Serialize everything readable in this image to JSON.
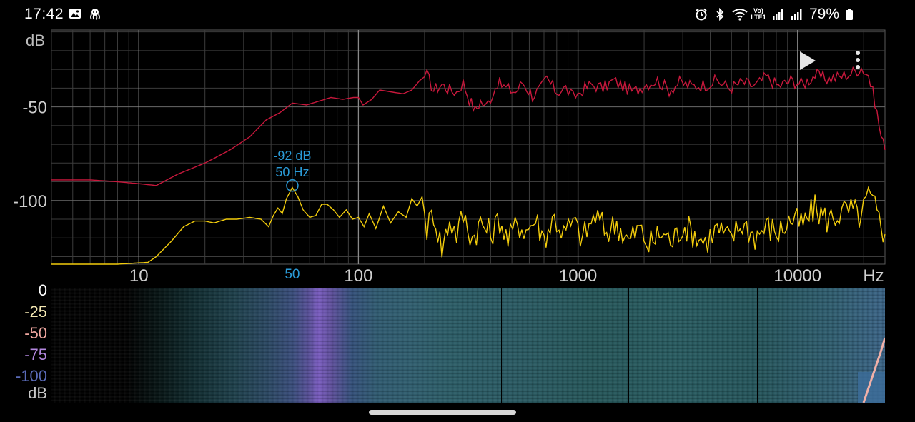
{
  "status_bar": {
    "time": "17:42",
    "battery": "79%",
    "left_icons": [
      "image-icon",
      "octopus-icon"
    ],
    "right_icons": [
      "alarm-icon",
      "bluetooth-icon",
      "wifi-icon",
      "volte-icon",
      "signal-icon",
      "signal-icon-2",
      "battery-icon"
    ],
    "volte_label": "Vo)\nLTE1"
  },
  "spectrum": {
    "db_unit": "dB",
    "hz_unit": "Hz",
    "peak_marker": {
      "db_text": "-92 dB",
      "hz_text": "50 Hz",
      "freq": 50,
      "db": -92
    },
    "marker_tick_label": "50",
    "colors": {
      "red": "#c8183c",
      "yellow": "#f2cc0c",
      "marker": "#2a9ad6",
      "grid": "#3c3c3c",
      "major_grid": "#8a8a8a"
    }
  },
  "chart_data": {
    "type": "line",
    "title": "",
    "xlabel": "Hz",
    "ylabel": "dB",
    "x_scale": "log",
    "xlim": [
      4,
      25000
    ],
    "ylim": [
      -134,
      -9
    ],
    "x_ticks": [
      {
        "value": 10,
        "label": "10"
      },
      {
        "value": 100,
        "label": "100"
      },
      {
        "value": 1000,
        "label": "1000"
      },
      {
        "value": 10000,
        "label": "10000"
      }
    ],
    "y_ticks": [
      {
        "value": -50,
        "label": "-50"
      },
      {
        "value": -100,
        "label": "-100"
      }
    ],
    "grid": true,
    "series": [
      {
        "color": "#c8183c",
        "points": [
          [
            4,
            -89
          ],
          [
            6,
            -89
          ],
          [
            8,
            -90
          ],
          [
            10,
            -91
          ],
          [
            12,
            -92
          ],
          [
            15,
            -86
          ],
          [
            20,
            -80
          ],
          [
            26,
            -73
          ],
          [
            32,
            -66
          ],
          [
            38,
            -57
          ],
          [
            44,
            -53
          ],
          [
            50,
            -48
          ],
          [
            58,
            -49
          ],
          [
            66,
            -47
          ],
          [
            75,
            -45
          ],
          [
            85,
            -46
          ],
          [
            95,
            -45
          ],
          [
            100,
            -45
          ],
          [
            105,
            -49
          ],
          [
            115,
            -46
          ],
          [
            125,
            -41
          ],
          [
            140,
            -42
          ],
          [
            160,
            -43
          ],
          [
            175,
            -41
          ],
          [
            190,
            -36
          ],
          [
            205,
            -33
          ],
          [
            220,
            -41
          ],
          [
            240,
            -38
          ],
          [
            260,
            -41
          ],
          [
            280,
            -42
          ],
          [
            300,
            -37
          ],
          [
            320,
            -46
          ],
          [
            340,
            -52
          ],
          [
            360,
            -47
          ],
          [
            380,
            -50
          ],
          [
            400,
            -45
          ],
          [
            430,
            -37
          ],
          [
            470,
            -40
          ],
          [
            520,
            -42
          ],
          [
            560,
            -37
          ],
          [
            620,
            -44
          ],
          [
            680,
            -40
          ],
          [
            720,
            -35
          ],
          [
            800,
            -42
          ],
          [
            880,
            -40
          ],
          [
            950,
            -45
          ],
          [
            1050,
            -41
          ],
          [
            1150,
            -38
          ],
          [
            1300,
            -40
          ],
          [
            1450,
            -36
          ],
          [
            1600,
            -39
          ],
          [
            1800,
            -42
          ],
          [
            2000,
            -38
          ],
          [
            2300,
            -36
          ],
          [
            2600,
            -41
          ],
          [
            2900,
            -37
          ],
          [
            3300,
            -39
          ],
          [
            3800,
            -38
          ],
          [
            4300,
            -36
          ],
          [
            4900,
            -40
          ],
          [
            5600,
            -37
          ],
          [
            6400,
            -39
          ],
          [
            7200,
            -34
          ],
          [
            8200,
            -39
          ],
          [
            9300,
            -36
          ],
          [
            10600,
            -38
          ],
          [
            12000,
            -33
          ],
          [
            13600,
            -35
          ],
          [
            15500,
            -34
          ],
          [
            17500,
            -32
          ],
          [
            19500,
            -29
          ],
          [
            21000,
            -33
          ],
          [
            22500,
            -47
          ],
          [
            24000,
            -66
          ],
          [
            25000,
            -73
          ]
        ]
      },
      {
        "color": "#f2cc0c",
        "points": [
          [
            4,
            -134
          ],
          [
            8,
            -134
          ],
          [
            11,
            -133
          ],
          [
            12,
            -130
          ],
          [
            14,
            -122
          ],
          [
            16,
            -114
          ],
          [
            18,
            -111
          ],
          [
            20,
            -111
          ],
          [
            22,
            -112
          ],
          [
            25,
            -110
          ],
          [
            28,
            -110
          ],
          [
            32,
            -109
          ],
          [
            36,
            -110
          ],
          [
            39,
            -114
          ],
          [
            41,
            -108
          ],
          [
            43,
            -104
          ],
          [
            45,
            -107
          ],
          [
            47,
            -99
          ],
          [
            50,
            -93
          ],
          [
            53,
            -98
          ],
          [
            56,
            -105
          ],
          [
            60,
            -109
          ],
          [
            64,
            -108
          ],
          [
            68,
            -102
          ],
          [
            72,
            -102
          ],
          [
            77,
            -105
          ],
          [
            82,
            -109
          ],
          [
            88,
            -105
          ],
          [
            94,
            -110
          ],
          [
            100,
            -109
          ],
          [
            106,
            -114
          ],
          [
            112,
            -107
          ],
          [
            120,
            -115
          ],
          [
            130,
            -103
          ],
          [
            140,
            -112
          ],
          [
            152,
            -106
          ],
          [
            165,
            -109
          ],
          [
            175,
            -99
          ],
          [
            185,
            -103
          ],
          [
            195,
            -98
          ],
          [
            205,
            -115
          ],
          [
            220,
            -106
          ],
          [
            240,
            -126
          ],
          [
            260,
            -110
          ],
          [
            280,
            -118
          ],
          [
            300,
            -108
          ],
          [
            330,
            -120
          ],
          [
            360,
            -112
          ],
          [
            400,
            -118
          ],
          [
            440,
            -110
          ],
          [
            480,
            -122
          ],
          [
            530,
            -112
          ],
          [
            580,
            -116
          ],
          [
            640,
            -110
          ],
          [
            700,
            -120
          ],
          [
            780,
            -109
          ],
          [
            860,
            -118
          ],
          [
            950,
            -112
          ],
          [
            1050,
            -120
          ],
          [
            1200,
            -108
          ],
          [
            1350,
            -117
          ],
          [
            1500,
            -112
          ],
          [
            1700,
            -122
          ],
          [
            1900,
            -115
          ],
          [
            2100,
            -124
          ],
          [
            2400,
            -117
          ],
          [
            2700,
            -122
          ],
          [
            3000,
            -113
          ],
          [
            3400,
            -118
          ],
          [
            3800,
            -122
          ],
          [
            4300,
            -115
          ],
          [
            4900,
            -121
          ],
          [
            5600,
            -112
          ],
          [
            6400,
            -119
          ],
          [
            7200,
            -114
          ],
          [
            8200,
            -117
          ],
          [
            9300,
            -110
          ],
          [
            10600,
            -113
          ],
          [
            12000,
            -104
          ],
          [
            13600,
            -110
          ],
          [
            15500,
            -107
          ],
          [
            17500,
            -105
          ],
          [
            19500,
            -109
          ],
          [
            21000,
            -97
          ],
          [
            22500,
            -104
          ],
          [
            24000,
            -114
          ],
          [
            25000,
            -118
          ]
        ]
      }
    ]
  },
  "spectrogram": {
    "scale_labels": [
      {
        "text": "0",
        "color": "#ffffff"
      },
      {
        "text": "-25",
        "color": "#f3e7b2"
      },
      {
        "text": "-50",
        "color": "#f0a7a0"
      },
      {
        "text": "-75",
        "color": "#b488e0"
      },
      {
        "text": "-100",
        "color": "#5a6bb8"
      },
      {
        "text": "dB",
        "color": "#c8c8c8"
      }
    ]
  }
}
